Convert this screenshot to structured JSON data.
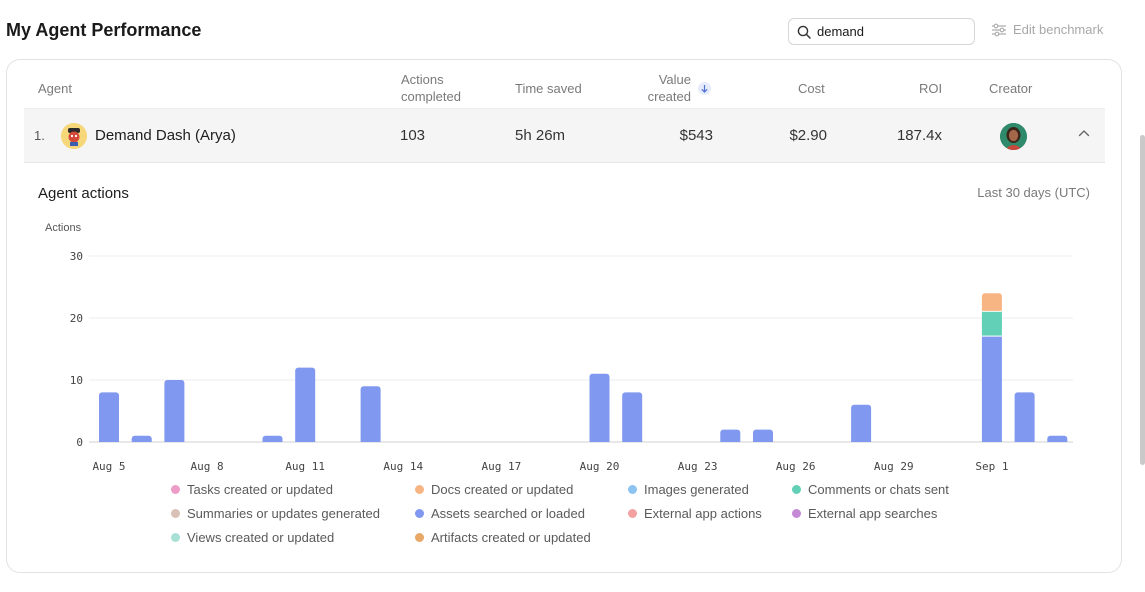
{
  "page": {
    "title": "My Agent Performance"
  },
  "search": {
    "value": "demand"
  },
  "toolbar": {
    "edit_benchmark_label": "Edit benchmark"
  },
  "table": {
    "headers": {
      "agent": "Agent",
      "actions_line1": "Actions",
      "actions_line2": "completed",
      "time_saved": "Time saved",
      "value_line1": "Value",
      "value_line2": "created",
      "cost": "Cost",
      "roi": "ROI",
      "creator": "Creator"
    },
    "sort": {
      "column": "value_created",
      "direction": "descending"
    },
    "rows": [
      {
        "rank": "1.",
        "name": "Demand Dash (Arya)",
        "actions_completed": "103",
        "time_saved": "5h 26m",
        "value_created": "$543",
        "cost": "$2.90",
        "roi": "187.4x"
      }
    ]
  },
  "details": {
    "title": "Agent actions",
    "range": "Last 30 days (UTC)"
  },
  "chart_data": {
    "type": "bar",
    "stacked": true,
    "ylabel": "Actions",
    "ylim": [
      0,
      30
    ],
    "yticks": [
      0,
      10,
      20,
      30
    ],
    "grid": true,
    "x": [
      "Aug 5",
      "Aug 6",
      "Aug 7",
      "Aug 8",
      "Aug 9",
      "Aug 10",
      "Aug 11",
      "Aug 12",
      "Aug 13",
      "Aug 14",
      "Aug 15",
      "Aug 16",
      "Aug 17",
      "Aug 18",
      "Aug 19",
      "Aug 20",
      "Aug 21",
      "Aug 22",
      "Aug 23",
      "Aug 24",
      "Aug 25",
      "Aug 26",
      "Aug 27",
      "Aug 28",
      "Aug 29",
      "Aug 30",
      "Aug 31",
      "Sep 1",
      "Sep 2",
      "Sep 3"
    ],
    "tick_labels": [
      "Aug 5",
      "Aug 8",
      "Aug 11",
      "Aug 14",
      "Aug 17",
      "Aug 20",
      "Aug 23",
      "Aug 26",
      "Aug 29",
      "Sep 1"
    ],
    "series": [
      {
        "name": "Assets searched or loaded",
        "color": "#8098f0",
        "values": [
          8,
          1,
          10,
          0,
          0,
          1,
          12,
          0,
          9,
          0,
          0,
          0,
          0,
          0,
          0,
          11,
          8,
          0,
          0,
          2,
          2,
          0,
          0,
          6,
          0,
          0,
          0,
          17,
          8,
          1
        ]
      },
      {
        "name": "Comments or chats sent",
        "color": "#62d0b6",
        "values": [
          0,
          0,
          0,
          0,
          0,
          0,
          0,
          0,
          0,
          0,
          0,
          0,
          0,
          0,
          0,
          0,
          0,
          0,
          0,
          0,
          0,
          0,
          0,
          0,
          0,
          0,
          0,
          4,
          0,
          0
        ]
      },
      {
        "name": "Docs created or updated",
        "color": "#f8b584",
        "values": [
          0,
          0,
          0,
          0,
          0,
          0,
          0,
          0,
          0,
          0,
          0,
          0,
          0,
          0,
          0,
          0,
          0,
          0,
          0,
          0,
          0,
          0,
          0,
          0,
          0,
          0,
          0,
          3,
          0,
          0
        ]
      }
    ],
    "legend": [
      {
        "name": "Tasks created or updated",
        "color": "#ec9cc6"
      },
      {
        "name": "Docs created or updated",
        "color": "#f8b584"
      },
      {
        "name": "Images generated",
        "color": "#8cc3f0"
      },
      {
        "name": "Comments or chats sent",
        "color": "#62d0b6"
      },
      {
        "name": "Summaries or updates generated",
        "color": "#d8c0b6"
      },
      {
        "name": "Assets searched or loaded",
        "color": "#8098f0"
      },
      {
        "name": "External app actions",
        "color": "#f3a0a0"
      },
      {
        "name": "External app searches",
        "color": "#c58ad6"
      },
      {
        "name": "Views created or updated",
        "color": "#a8e0d6"
      },
      {
        "name": "Artifacts created or updated",
        "color": "#e8a866"
      }
    ]
  }
}
